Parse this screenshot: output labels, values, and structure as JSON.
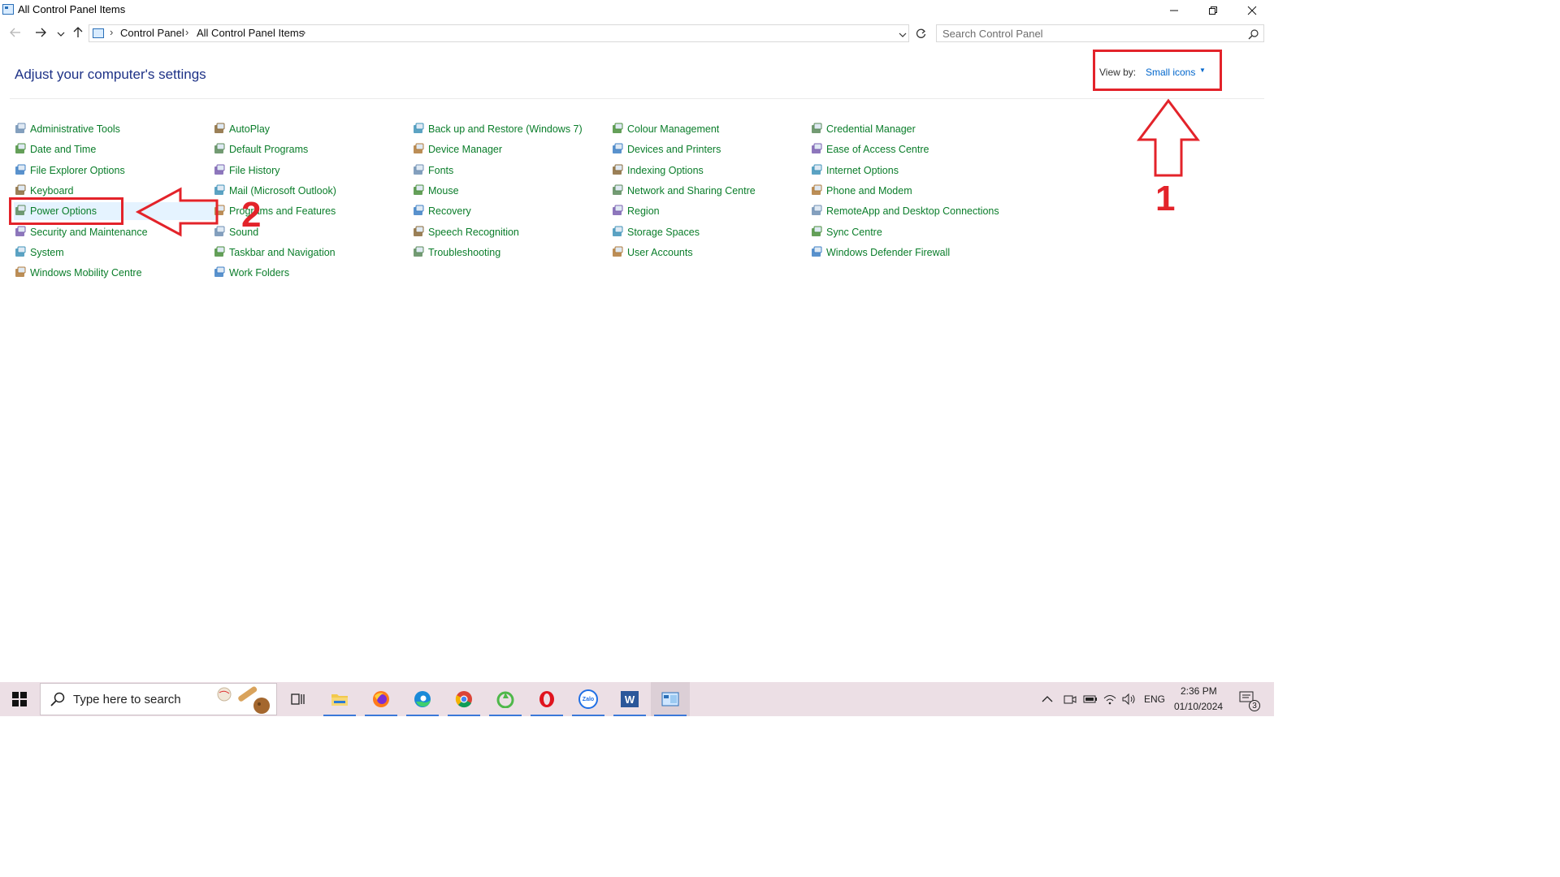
{
  "window": {
    "title": "All Control Panel Items",
    "minimize_icon": "minimize-icon",
    "restore_icon": "restore-icon",
    "close_icon": "close-icon"
  },
  "address_bar": {
    "breadcrumbs": [
      "Control Panel",
      "All Control Panel Items"
    ],
    "search_placeholder": "Search Control Panel"
  },
  "header": {
    "title": "Adjust your computer's settings",
    "view_by_label": "View by:",
    "view_by_value": "Small icons"
  },
  "items": [
    [
      "Administrative Tools",
      "Date and Time",
      "File Explorer Options",
      "Keyboard",
      "Power Options",
      "Security and Maintenance",
      "System",
      "Windows Mobility Centre"
    ],
    [
      "AutoPlay",
      "Default Programs",
      "File History",
      "Mail (Microsoft Outlook)",
      "Programs and Features",
      "Sound",
      "Taskbar and Navigation",
      "Work Folders"
    ],
    [
      "Back up and Restore (Windows 7)",
      "Device Manager",
      "Fonts",
      "Mouse",
      "Recovery",
      "Speech Recognition",
      "Troubleshooting"
    ],
    [
      "Colour Management",
      "Devices and Printers",
      "Indexing Options",
      "Network and Sharing Centre",
      "Region",
      "Storage Spaces",
      "User Accounts"
    ],
    [
      "Credential Manager",
      "Ease of Access Centre",
      "Internet Options",
      "Phone and Modem",
      "RemoteApp and Desktop Connections",
      "Sync Centre",
      "Windows Defender Firewall"
    ]
  ],
  "highlighted_item": "Power Options",
  "annotations": {
    "step1": "1",
    "step2": "2",
    "color": "#e3232a"
  },
  "taskbar": {
    "search_text": "Type here to search",
    "apps": [
      "task-view",
      "file-explorer",
      "firefox",
      "edge",
      "chrome",
      "app-green",
      "opera",
      "zalo",
      "word",
      "control-panel"
    ],
    "zalo_label": "Zalo",
    "word_label": "W",
    "language": "ENG",
    "time": "2:36 PM",
    "date": "01/10/2024",
    "notification_count": "3"
  },
  "colors": {
    "link_green": "#0a7d2a",
    "heading_blue": "#1e3287",
    "accent_blue": "#0066cc",
    "annotation_red": "#e3232a",
    "taskbar_bg": "#ecdfe5"
  }
}
